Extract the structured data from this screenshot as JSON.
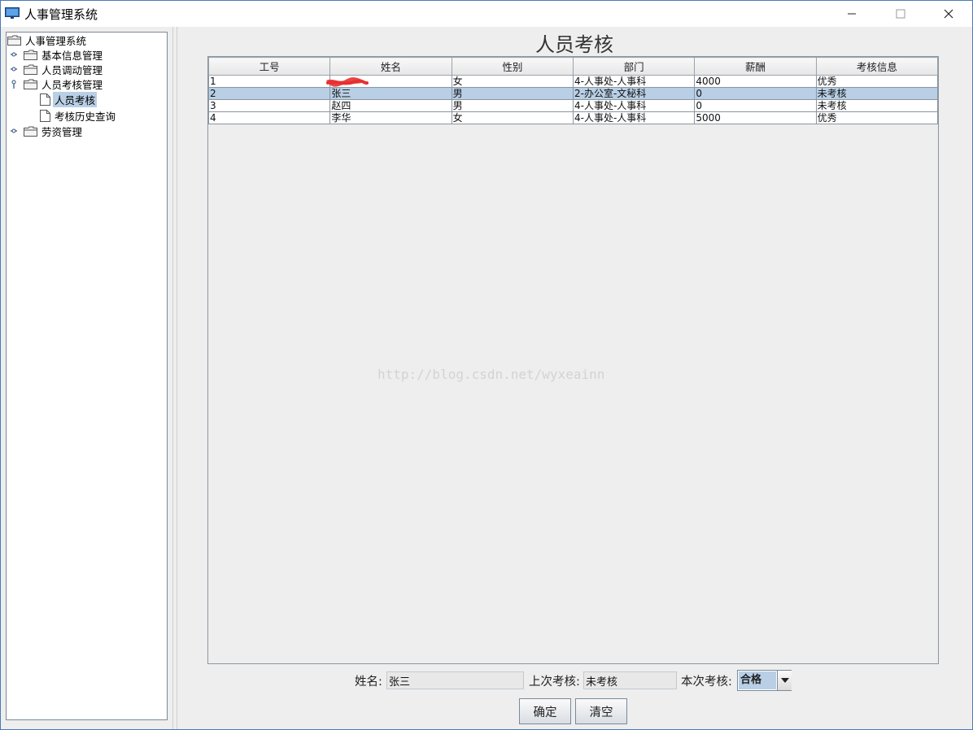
{
  "window": {
    "title": "人事管理系统"
  },
  "tree": {
    "root": "人事管理系统",
    "items": [
      {
        "label": "基本信息管理"
      },
      {
        "label": "人员调动管理"
      },
      {
        "label": "人员考核管理"
      },
      {
        "label": "人员考核"
      },
      {
        "label": "考核历史查询"
      },
      {
        "label": "劳资管理"
      }
    ]
  },
  "page": {
    "title": "人员考核",
    "watermark": "http://blog.csdn.net/wyxeainn"
  },
  "table": {
    "headers": [
      "工号",
      "姓名",
      "性别",
      "部门",
      "薪酬",
      "考核信息"
    ],
    "rows": [
      [
        "1",
        "",
        "女",
        "4-人事处-人事科",
        "4000",
        "优秀"
      ],
      [
        "2",
        "张三",
        "男",
        "2-办公室-文秘科",
        "0",
        "未考核"
      ],
      [
        "3",
        "赵四",
        "男",
        "4-人事处-人事科",
        "0",
        "未考核"
      ],
      [
        "4",
        "李华",
        "女",
        "4-人事处-人事科",
        "5000",
        "优秀"
      ]
    ],
    "selected_row": 1
  },
  "form": {
    "name_label": "姓名:",
    "name_value": "张三",
    "last_label": "上次考核:",
    "last_value": "未考核",
    "current_label": "本次考核:",
    "current_value": "合格",
    "confirm_label": "确定",
    "clear_label": "清空"
  },
  "colors": {
    "selection": "#b8cfe5",
    "scribble": "#e83030"
  }
}
